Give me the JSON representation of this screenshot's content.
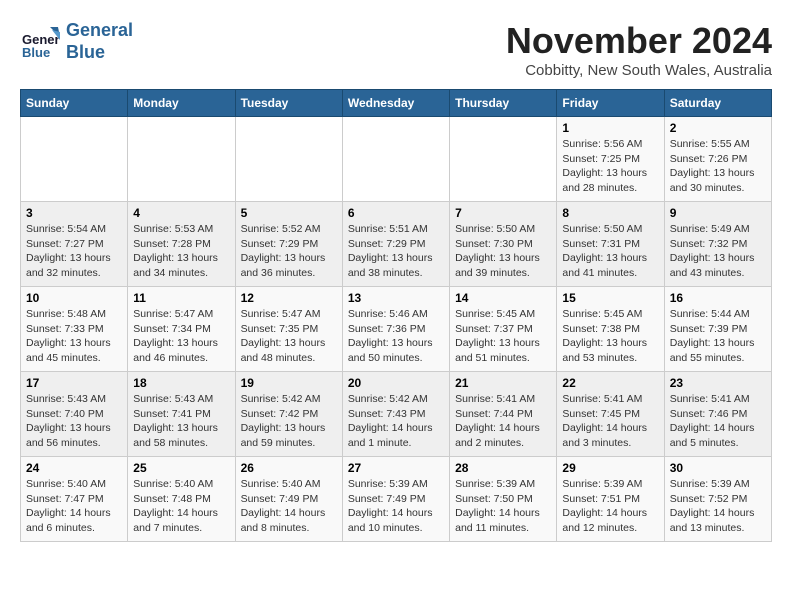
{
  "header": {
    "logo_line1": "General",
    "logo_line2": "Blue",
    "month_title": "November 2024",
    "location": "Cobbitty, New South Wales, Australia"
  },
  "days_of_week": [
    "Sunday",
    "Monday",
    "Tuesday",
    "Wednesday",
    "Thursday",
    "Friday",
    "Saturday"
  ],
  "weeks": [
    [
      {
        "day": "",
        "info": ""
      },
      {
        "day": "",
        "info": ""
      },
      {
        "day": "",
        "info": ""
      },
      {
        "day": "",
        "info": ""
      },
      {
        "day": "",
        "info": ""
      },
      {
        "day": "1",
        "info": "Sunrise: 5:56 AM\nSunset: 7:25 PM\nDaylight: 13 hours and 28 minutes."
      },
      {
        "day": "2",
        "info": "Sunrise: 5:55 AM\nSunset: 7:26 PM\nDaylight: 13 hours and 30 minutes."
      }
    ],
    [
      {
        "day": "3",
        "info": "Sunrise: 5:54 AM\nSunset: 7:27 PM\nDaylight: 13 hours and 32 minutes."
      },
      {
        "day": "4",
        "info": "Sunrise: 5:53 AM\nSunset: 7:28 PM\nDaylight: 13 hours and 34 minutes."
      },
      {
        "day": "5",
        "info": "Sunrise: 5:52 AM\nSunset: 7:29 PM\nDaylight: 13 hours and 36 minutes."
      },
      {
        "day": "6",
        "info": "Sunrise: 5:51 AM\nSunset: 7:29 PM\nDaylight: 13 hours and 38 minutes."
      },
      {
        "day": "7",
        "info": "Sunrise: 5:50 AM\nSunset: 7:30 PM\nDaylight: 13 hours and 39 minutes."
      },
      {
        "day": "8",
        "info": "Sunrise: 5:50 AM\nSunset: 7:31 PM\nDaylight: 13 hours and 41 minutes."
      },
      {
        "day": "9",
        "info": "Sunrise: 5:49 AM\nSunset: 7:32 PM\nDaylight: 13 hours and 43 minutes."
      }
    ],
    [
      {
        "day": "10",
        "info": "Sunrise: 5:48 AM\nSunset: 7:33 PM\nDaylight: 13 hours and 45 minutes."
      },
      {
        "day": "11",
        "info": "Sunrise: 5:47 AM\nSunset: 7:34 PM\nDaylight: 13 hours and 46 minutes."
      },
      {
        "day": "12",
        "info": "Sunrise: 5:47 AM\nSunset: 7:35 PM\nDaylight: 13 hours and 48 minutes."
      },
      {
        "day": "13",
        "info": "Sunrise: 5:46 AM\nSunset: 7:36 PM\nDaylight: 13 hours and 50 minutes."
      },
      {
        "day": "14",
        "info": "Sunrise: 5:45 AM\nSunset: 7:37 PM\nDaylight: 13 hours and 51 minutes."
      },
      {
        "day": "15",
        "info": "Sunrise: 5:45 AM\nSunset: 7:38 PM\nDaylight: 13 hours and 53 minutes."
      },
      {
        "day": "16",
        "info": "Sunrise: 5:44 AM\nSunset: 7:39 PM\nDaylight: 13 hours and 55 minutes."
      }
    ],
    [
      {
        "day": "17",
        "info": "Sunrise: 5:43 AM\nSunset: 7:40 PM\nDaylight: 13 hours and 56 minutes."
      },
      {
        "day": "18",
        "info": "Sunrise: 5:43 AM\nSunset: 7:41 PM\nDaylight: 13 hours and 58 minutes."
      },
      {
        "day": "19",
        "info": "Sunrise: 5:42 AM\nSunset: 7:42 PM\nDaylight: 13 hours and 59 minutes."
      },
      {
        "day": "20",
        "info": "Sunrise: 5:42 AM\nSunset: 7:43 PM\nDaylight: 14 hours and 1 minute."
      },
      {
        "day": "21",
        "info": "Sunrise: 5:41 AM\nSunset: 7:44 PM\nDaylight: 14 hours and 2 minutes."
      },
      {
        "day": "22",
        "info": "Sunrise: 5:41 AM\nSunset: 7:45 PM\nDaylight: 14 hours and 3 minutes."
      },
      {
        "day": "23",
        "info": "Sunrise: 5:41 AM\nSunset: 7:46 PM\nDaylight: 14 hours and 5 minutes."
      }
    ],
    [
      {
        "day": "24",
        "info": "Sunrise: 5:40 AM\nSunset: 7:47 PM\nDaylight: 14 hours and 6 minutes."
      },
      {
        "day": "25",
        "info": "Sunrise: 5:40 AM\nSunset: 7:48 PM\nDaylight: 14 hours and 7 minutes."
      },
      {
        "day": "26",
        "info": "Sunrise: 5:40 AM\nSunset: 7:49 PM\nDaylight: 14 hours and 8 minutes."
      },
      {
        "day": "27",
        "info": "Sunrise: 5:39 AM\nSunset: 7:49 PM\nDaylight: 14 hours and 10 minutes."
      },
      {
        "day": "28",
        "info": "Sunrise: 5:39 AM\nSunset: 7:50 PM\nDaylight: 14 hours and 11 minutes."
      },
      {
        "day": "29",
        "info": "Sunrise: 5:39 AM\nSunset: 7:51 PM\nDaylight: 14 hours and 12 minutes."
      },
      {
        "day": "30",
        "info": "Sunrise: 5:39 AM\nSunset: 7:52 PM\nDaylight: 14 hours and 13 minutes."
      }
    ]
  ]
}
